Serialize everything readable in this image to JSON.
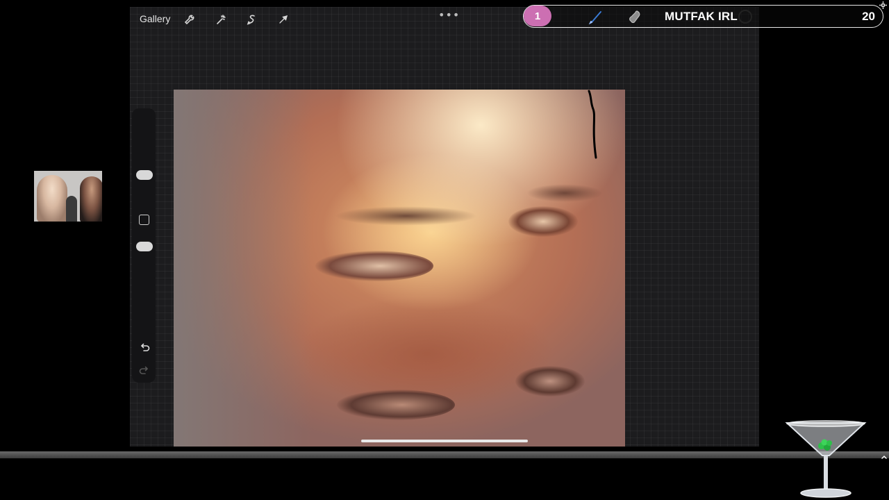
{
  "topbar": {
    "gallery_label": "Gallery",
    "tools": [
      "wrench-icon",
      "magic-wand-icon",
      "selection-icon",
      "transform-arrow-icon"
    ],
    "more_label": "•••"
  },
  "stream_overlay": {
    "badge": "1",
    "title": "MUTFAK IRL",
    "count": "20",
    "badge_color": "#cc6fb2",
    "icons": [
      "brush-icon",
      "smudge-icon"
    ]
  },
  "sidebar": {
    "icons": [
      "brush-size-slider",
      "modify-button",
      "opacity-slider",
      "undo-icon",
      "redo-icon"
    ]
  },
  "canvas": {
    "subject": "artwork-reference-image"
  },
  "colors": {
    "background": "#000000",
    "ipad_bg": "#1c1c1e",
    "accent": "#cc6fb2"
  }
}
